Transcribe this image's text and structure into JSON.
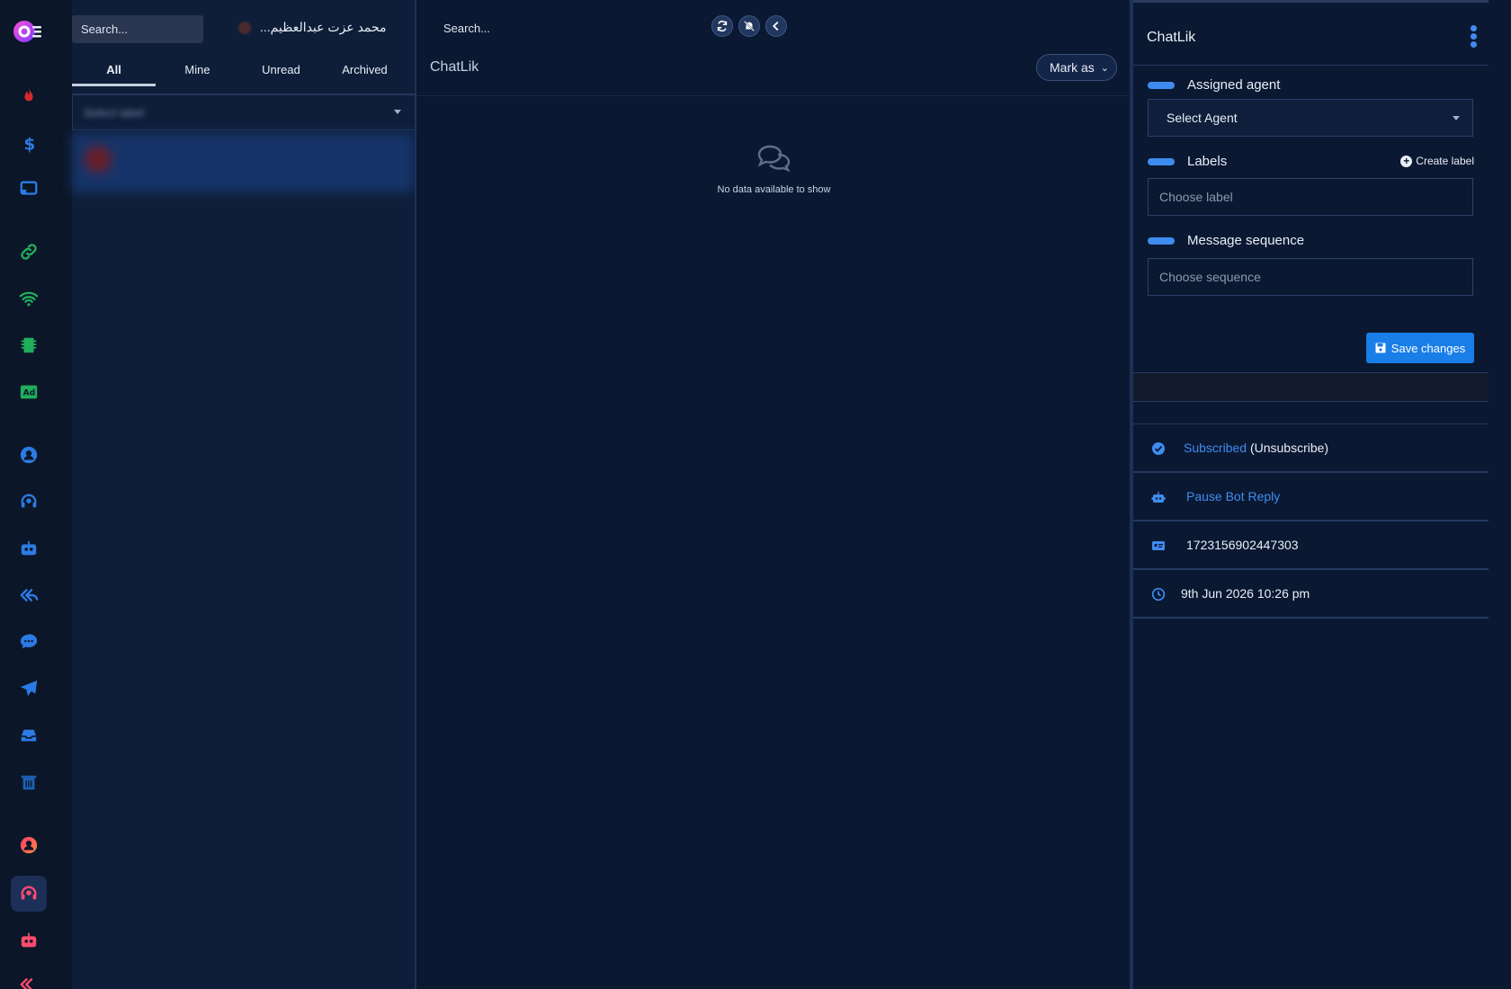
{
  "rail": {
    "icons": [
      "fire-icon",
      "dollar-icon",
      "cast-icon",
      "link-icon",
      "wifi-icon",
      "chip-icon",
      "ad-icon",
      "user-circle-icon",
      "headset-icon",
      "robot-icon",
      "reply-all-icon",
      "chat-bubble-icon",
      "paper-plane-icon",
      "inbox-icon",
      "trash-icon",
      "user-circle-gradient-icon",
      "headset-gradient-icon",
      "robot-gradient-icon",
      "reply-gradient-icon"
    ]
  },
  "list": {
    "search_placeholder": "Search...",
    "contact_name": "محمد عزت عبدالعظيم...",
    "tabs": [
      "All",
      "Mine",
      "Unread",
      "Archived"
    ],
    "active_tab": "All",
    "filter_text": "Select label"
  },
  "chat": {
    "search_placeholder": "Search...",
    "title": "ChatLik",
    "mark_as": "Mark as",
    "empty_text": "No data available to show"
  },
  "details": {
    "title": "ChatLik",
    "assigned_agent_label": "Assigned agent",
    "select_agent": "Select Agent",
    "labels_label": "Labels",
    "create_label": "Create label",
    "choose_label": "Choose label",
    "sequence_label": "Message sequence",
    "choose_sequence": "Choose sequence",
    "save_changes": "Save changes",
    "subscribed": "Subscribed",
    "unsubscribe": "(Unsubscribe)",
    "pause_bot": "Pause Bot Reply",
    "subscriber_id": "1723156902447303",
    "datetime": "9th Jun 2026 10:26 pm"
  },
  "colors": {
    "accent": "#3f8cf0",
    "save_button": "#1a7ee8",
    "background": "#0b1832"
  }
}
